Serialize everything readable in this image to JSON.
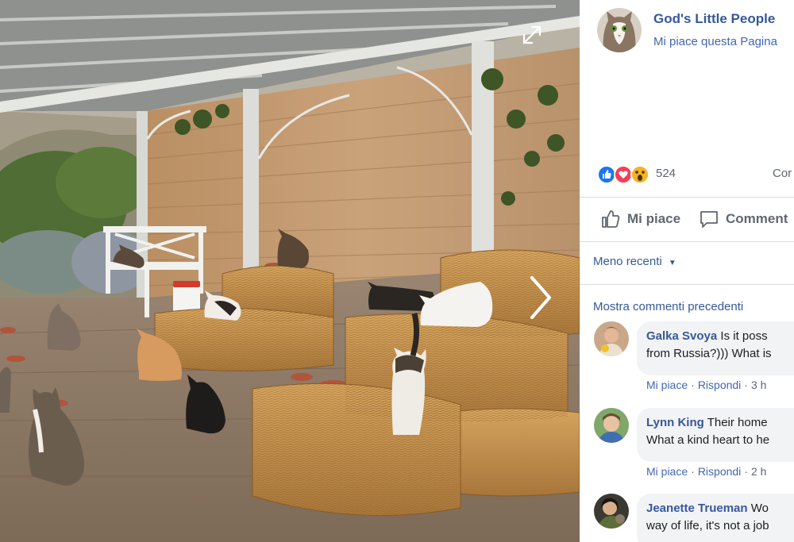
{
  "viewer": {
    "expand_icon": "expand-icon",
    "next_icon": "chevron-right-icon"
  },
  "post": {
    "page_name": "God's Little People",
    "page_like_text": "Mi piace questa Pagina",
    "reactions": [
      "like",
      "love",
      "wow"
    ],
    "reaction_count": "524",
    "comments_count_label": "Cor",
    "like_label": "Mi piace",
    "comment_label": "Comment"
  },
  "comments_panel": {
    "sort_label": "Meno recenti",
    "more_comments": "Mostra commenti precedenti",
    "items": [
      {
        "author": "Galka Svoya",
        "line1": "Is it poss",
        "line2": "from Russia?))) What is",
        "like": "Mi piace",
        "reply": "Rispondi",
        "time": "3 h"
      },
      {
        "author": "Lynn King",
        "line1": "Their home",
        "line2": "What a kind heart to he",
        "like": "Mi piace",
        "reply": "Rispondi",
        "time": "2 h"
      },
      {
        "author": "Jeanette Trueman",
        "line1": "Wo",
        "line2": "way of life, it's not a job"
      }
    ]
  },
  "colors": {
    "link_blue": "#365899",
    "action_gray": "#606770",
    "bubble_bg": "#f2f3f5",
    "like_blue": "#1877f2",
    "love_red": "#f33e58",
    "wow_yellow": "#f7b125"
  }
}
